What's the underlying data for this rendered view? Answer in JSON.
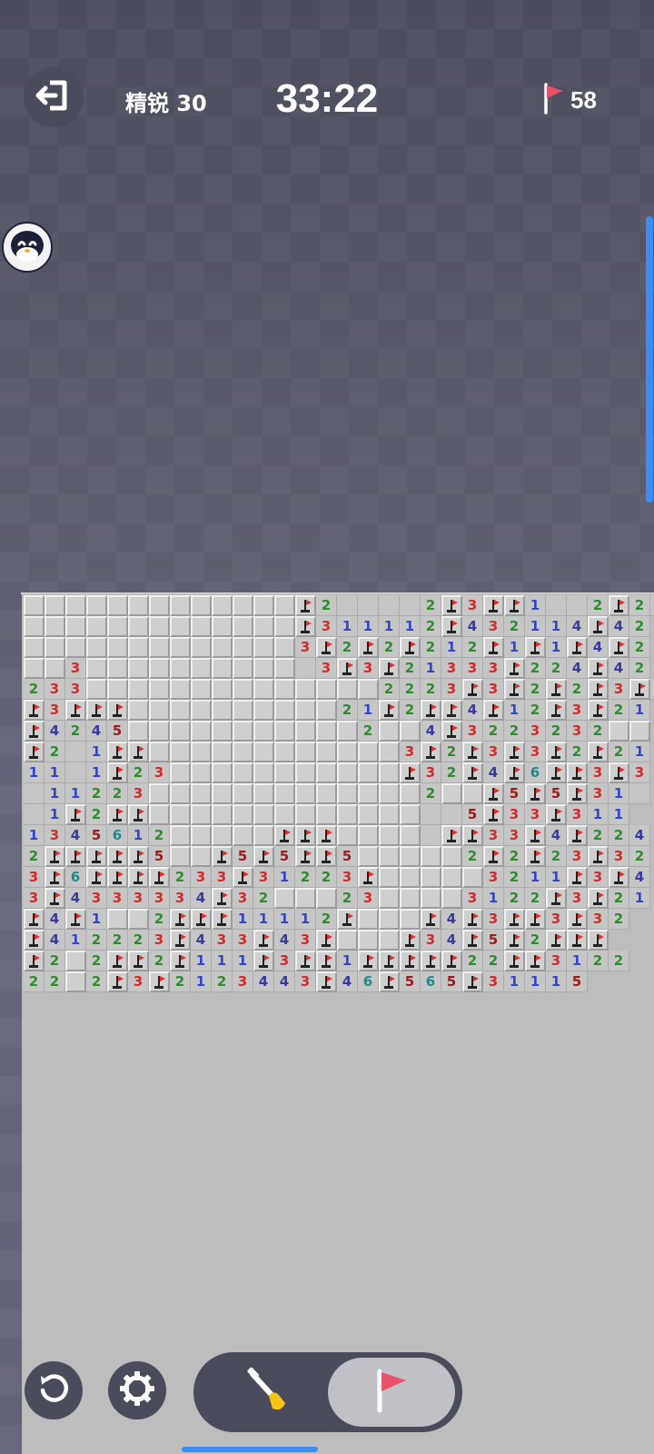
{
  "header": {
    "difficulty": "精锐 30",
    "timer": "33:22",
    "flags_remaining": "58"
  },
  "icons": {
    "exit": "exit-icon",
    "mascot": "penguin-mascot-icon",
    "flag": "flag-icon",
    "restart": "restart-icon",
    "settings": "gear-icon",
    "dig": "shovel-icon"
  },
  "colors": {
    "num1": "#3346c8",
    "num2": "#2e8b2e",
    "num3": "#d22b2b",
    "num4": "#3a3a9a",
    "num5": "#9b1b1b",
    "num6": "#1e8a8a",
    "accent": "#3d8cf0",
    "flag": "#e8526a"
  },
  "board": {
    "legend": "# = unopened, F = flagged, . = empty revealed, digit = adjacent mine count",
    "rows": [
      "#############F2....2F3FF1..2F2.",
      "#############F311112F432114F42",
      "#############3F2F2F212F1F1F4F2",
      "##3##########.3F3F21333F224F42",
      "233##############2223F3F2F2F3F2",
      "F3FFF##########21F2FF4F12F3F21",
      "F4245###########2##4F3223232##",
      "F2.1FF############3F2F3F3F2F21",
      "11.1F23###########F32F4F6FF3F3",
      ".11223#############2##F5F5F31.",
      ".1F2FF#############..5F33F311",
      "1345612#####FFF####.FF33F4F224",
      "2FFFFF5##F5F5FF5#####2F2F23F32",
      "3F6FFFF233F31223F#####3211F3F4",
      "3F4333334F32###23####3122F3F21",
      "F4F1##2FFF11112F###F4F3FF3F32",
      "F412223F433F43F###F34F5F2FFF",
      "F2#2FF2F111F3FF1FFFFF22FF3122",
      "22#2F3F2123443F46F565F31115"
    ]
  }
}
